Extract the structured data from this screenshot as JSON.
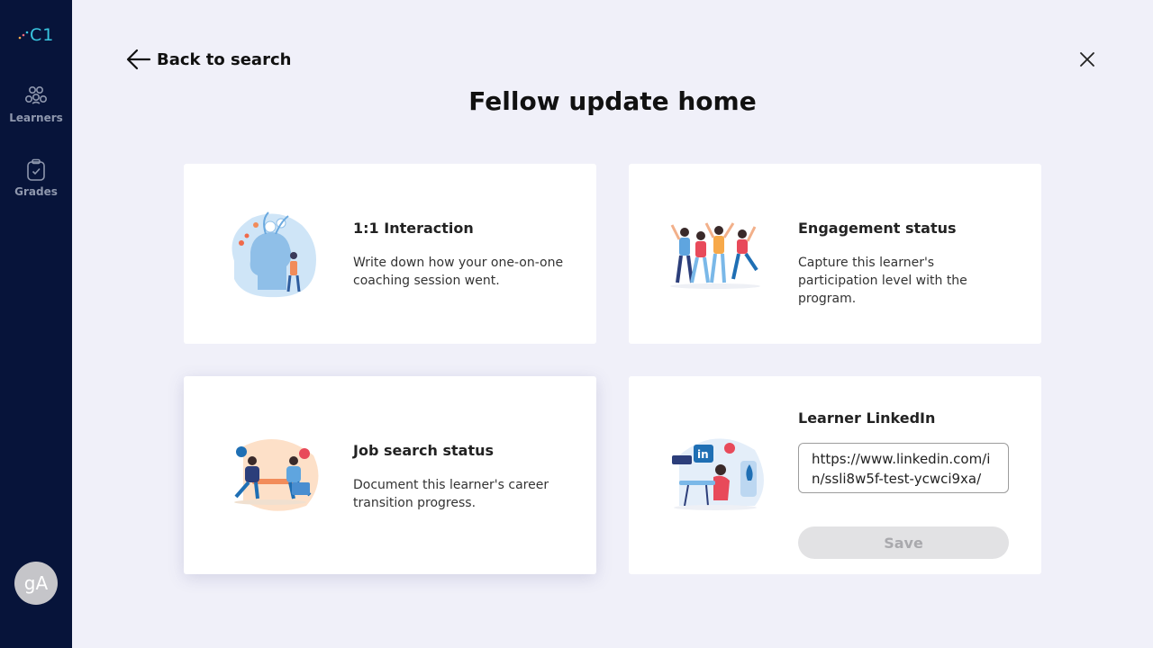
{
  "sidebar": {
    "logo_text": "C1",
    "items": [
      {
        "label": "Learners",
        "icon": "learners-icon"
      },
      {
        "label": "Grades",
        "icon": "clipboard-check-icon"
      }
    ],
    "avatar_initials": "gA"
  },
  "header": {
    "back_label": "Back to search",
    "title": "Fellow update home"
  },
  "cards": [
    {
      "title": "1:1 Interaction",
      "description": "Write down how your one-on-one coaching session went."
    },
    {
      "title": "Engagement status",
      "description": "Capture this learner's participation level with the program."
    },
    {
      "title": "Job search status",
      "description": "Document this learner's career transition progress."
    },
    {
      "title": "Learner LinkedIn",
      "input_value": "https://www.linkedin.com/in/ssli8w5f-test-ycwci9xa/",
      "save_label": "Save"
    }
  ],
  "colors": {
    "sidebar": "#07143a",
    "background": "#f0f0f9",
    "logo": "#39c6e0"
  }
}
